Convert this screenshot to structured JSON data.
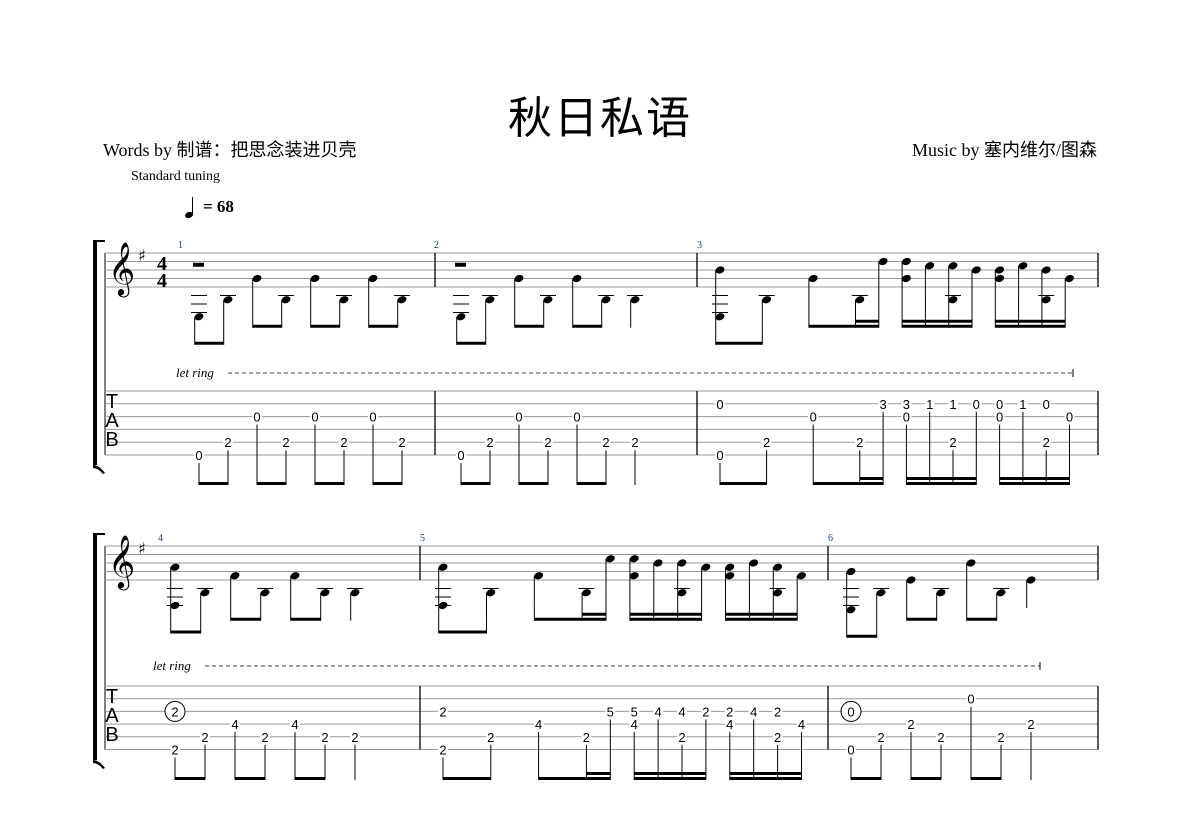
{
  "title": "秋日私语",
  "words_by": "Words by 制谱：把思念装进贝壳",
  "music_by": "Music by 塞内维尔/图森",
  "tuning": "Standard tuning",
  "tempo": "= 68",
  "time_signature": [
    "4",
    "4"
  ],
  "tab_clef": [
    "T",
    "A",
    "B"
  ],
  "let_ring": "let ring",
  "systems": [
    {
      "measures": [
        {
          "number": "1",
          "events": [
            {
              "beat": 0,
              "dur": 8,
              "notes": [
                {
                  "s": 6,
                  "f": "0"
                }
              ]
            },
            {
              "beat": 2,
              "dur": 8,
              "notes": [
                {
                  "s": 5,
                  "f": "2"
                }
              ]
            },
            {
              "beat": 4,
              "dur": 8,
              "notes": [
                {
                  "s": 3,
                  "f": "0"
                }
              ]
            },
            {
              "beat": 6,
              "dur": 8,
              "notes": [
                {
                  "s": 5,
                  "f": "2"
                }
              ]
            },
            {
              "beat": 8,
              "dur": 8,
              "notes": [
                {
                  "s": 3,
                  "f": "0"
                }
              ]
            },
            {
              "beat": 10,
              "dur": 8,
              "notes": [
                {
                  "s": 5,
                  "f": "2"
                }
              ]
            },
            {
              "beat": 12,
              "dur": 8,
              "notes": [
                {
                  "s": 3,
                  "f": "0"
                }
              ]
            },
            {
              "beat": 14,
              "dur": 8,
              "notes": [
                {
                  "s": 5,
                  "f": "2"
                }
              ]
            }
          ]
        },
        {
          "number": "2",
          "events": [
            {
              "beat": 0,
              "dur": 8,
              "notes": [
                {
                  "s": 6,
                  "f": "0"
                }
              ]
            },
            {
              "beat": 2,
              "dur": 8,
              "notes": [
                {
                  "s": 5,
                  "f": "2"
                }
              ]
            },
            {
              "beat": 4,
              "dur": 8,
              "notes": [
                {
                  "s": 3,
                  "f": "0"
                }
              ]
            },
            {
              "beat": 6,
              "dur": 8,
              "notes": [
                {
                  "s": 5,
                  "f": "2"
                }
              ]
            },
            {
              "beat": 8,
              "dur": 8,
              "notes": [
                {
                  "s": 3,
                  "f": "0"
                }
              ]
            },
            {
              "beat": 10,
              "dur": 8,
              "notes": [
                {
                  "s": 5,
                  "f": "2"
                }
              ]
            },
            {
              "beat": 12,
              "dur": 4,
              "notes": [
                {
                  "s": 5,
                  "f": "2"
                }
              ]
            }
          ]
        },
        {
          "number": "3",
          "events": [
            {
              "beat": 0,
              "dur": 8,
              "notes": [
                {
                  "s": 2,
                  "f": "0"
                },
                {
                  "s": 6,
                  "f": "0"
                }
              ]
            },
            {
              "beat": 2,
              "dur": 8,
              "notes": [
                {
                  "s": 5,
                  "f": "2"
                }
              ]
            },
            {
              "beat": 4,
              "dur": 8,
              "notes": [
                {
                  "s": 3,
                  "f": "0"
                }
              ]
            },
            {
              "beat": 6,
              "dur": 16,
              "notes": [
                {
                  "s": 5,
                  "f": "2"
                }
              ]
            },
            {
              "beat": 7,
              "dur": 16,
              "notes": [
                {
                  "s": 2,
                  "f": "3"
                }
              ]
            },
            {
              "beat": 8,
              "dur": 16,
              "notes": [
                {
                  "s": 2,
                  "f": "3"
                },
                {
                  "s": 3,
                  "f": "0"
                }
              ]
            },
            {
              "beat": 9,
              "dur": 16,
              "notes": [
                {
                  "s": 2,
                  "f": "1"
                }
              ]
            },
            {
              "beat": 10,
              "dur": 16,
              "notes": [
                {
                  "s": 2,
                  "f": "1"
                },
                {
                  "s": 5,
                  "f": "2"
                }
              ]
            },
            {
              "beat": 11,
              "dur": 16,
              "notes": [
                {
                  "s": 2,
                  "f": "0"
                }
              ]
            },
            {
              "beat": 12,
              "dur": 16,
              "notes": [
                {
                  "s": 2,
                  "f": "0"
                },
                {
                  "s": 3,
                  "f": "0"
                }
              ]
            },
            {
              "beat": 13,
              "dur": 16,
              "notes": [
                {
                  "s": 2,
                  "f": "1"
                }
              ]
            },
            {
              "beat": 14,
              "dur": 16,
              "notes": [
                {
                  "s": 2,
                  "f": "0"
                },
                {
                  "s": 5,
                  "f": "2"
                }
              ]
            },
            {
              "beat": 15,
              "dur": 16,
              "notes": [
                {
                  "s": 3,
                  "f": "0"
                }
              ]
            }
          ]
        }
      ]
    },
    {
      "measures": [
        {
          "number": "4",
          "events": [
            {
              "beat": 0,
              "dur": 8,
              "notes": [
                {
                  "s": 3,
                  "f": "2",
                  "circled": true
                },
                {
                  "s": 6,
                  "f": "2"
                }
              ]
            },
            {
              "beat": 2,
              "dur": 8,
              "notes": [
                {
                  "s": 5,
                  "f": "2"
                }
              ]
            },
            {
              "beat": 4,
              "dur": 8,
              "notes": [
                {
                  "s": 4,
                  "f": "4"
                }
              ]
            },
            {
              "beat": 6,
              "dur": 8,
              "notes": [
                {
                  "s": 5,
                  "f": "2"
                }
              ]
            },
            {
              "beat": 8,
              "dur": 8,
              "notes": [
                {
                  "s": 4,
                  "f": "4"
                }
              ]
            },
            {
              "beat": 10,
              "dur": 8,
              "notes": [
                {
                  "s": 5,
                  "f": "2"
                }
              ]
            },
            {
              "beat": 12,
              "dur": 4,
              "notes": [
                {
                  "s": 5,
                  "f": "2"
                }
              ]
            }
          ]
        },
        {
          "number": "5",
          "events": [
            {
              "beat": 0,
              "dur": 8,
              "notes": [
                {
                  "s": 3,
                  "f": "2"
                },
                {
                  "s": 6,
                  "f": "2"
                }
              ]
            },
            {
              "beat": 2,
              "dur": 8,
              "notes": [
                {
                  "s": 5,
                  "f": "2"
                }
              ]
            },
            {
              "beat": 4,
              "dur": 8,
              "notes": [
                {
                  "s": 4,
                  "f": "4"
                }
              ]
            },
            {
              "beat": 6,
              "dur": 16,
              "notes": [
                {
                  "s": 5,
                  "f": "2"
                }
              ]
            },
            {
              "beat": 7,
              "dur": 16,
              "notes": [
                {
                  "s": 3,
                  "f": "5"
                }
              ]
            },
            {
              "beat": 8,
              "dur": 16,
              "notes": [
                {
                  "s": 3,
                  "f": "5"
                },
                {
                  "s": 4,
                  "f": "4"
                }
              ]
            },
            {
              "beat": 9,
              "dur": 16,
              "notes": [
                {
                  "s": 3,
                  "f": "4"
                }
              ]
            },
            {
              "beat": 10,
              "dur": 16,
              "notes": [
                {
                  "s": 3,
                  "f": "4"
                },
                {
                  "s": 5,
                  "f": "2"
                }
              ]
            },
            {
              "beat": 11,
              "dur": 16,
              "notes": [
                {
                  "s": 3,
                  "f": "2"
                }
              ]
            },
            {
              "beat": 12,
              "dur": 16,
              "notes": [
                {
                  "s": 3,
                  "f": "2"
                },
                {
                  "s": 4,
                  "f": "4"
                }
              ]
            },
            {
              "beat": 13,
              "dur": 16,
              "notes": [
                {
                  "s": 3,
                  "f": "4"
                }
              ]
            },
            {
              "beat": 14,
              "dur": 16,
              "notes": [
                {
                  "s": 3,
                  "f": "2"
                },
                {
                  "s": 5,
                  "f": "2"
                }
              ]
            },
            {
              "beat": 15,
              "dur": 16,
              "notes": [
                {
                  "s": 4,
                  "f": "4"
                }
              ]
            }
          ]
        },
        {
          "number": "6",
          "events": [
            {
              "beat": 0,
              "dur": 8,
              "notes": [
                {
                  "s": 3,
                  "f": "0",
                  "circled": true
                },
                {
                  "s": 6,
                  "f": "0"
                }
              ]
            },
            {
              "beat": 2,
              "dur": 8,
              "notes": [
                {
                  "s": 5,
                  "f": "2"
                }
              ]
            },
            {
              "beat": 4,
              "dur": 8,
              "notes": [
                {
                  "s": 4,
                  "f": "2"
                }
              ]
            },
            {
              "beat": 6,
              "dur": 8,
              "notes": [
                {
                  "s": 5,
                  "f": "2"
                }
              ]
            },
            {
              "beat": 8,
              "dur": 8,
              "notes": [
                {
                  "s": 2,
                  "f": "0"
                }
              ]
            },
            {
              "beat": 10,
              "dur": 8,
              "notes": [
                {
                  "s": 5,
                  "f": "2"
                }
              ]
            },
            {
              "beat": 12,
              "dur": 4,
              "notes": [
                {
                  "s": 4,
                  "f": "2"
                }
              ]
            }
          ]
        }
      ]
    }
  ]
}
